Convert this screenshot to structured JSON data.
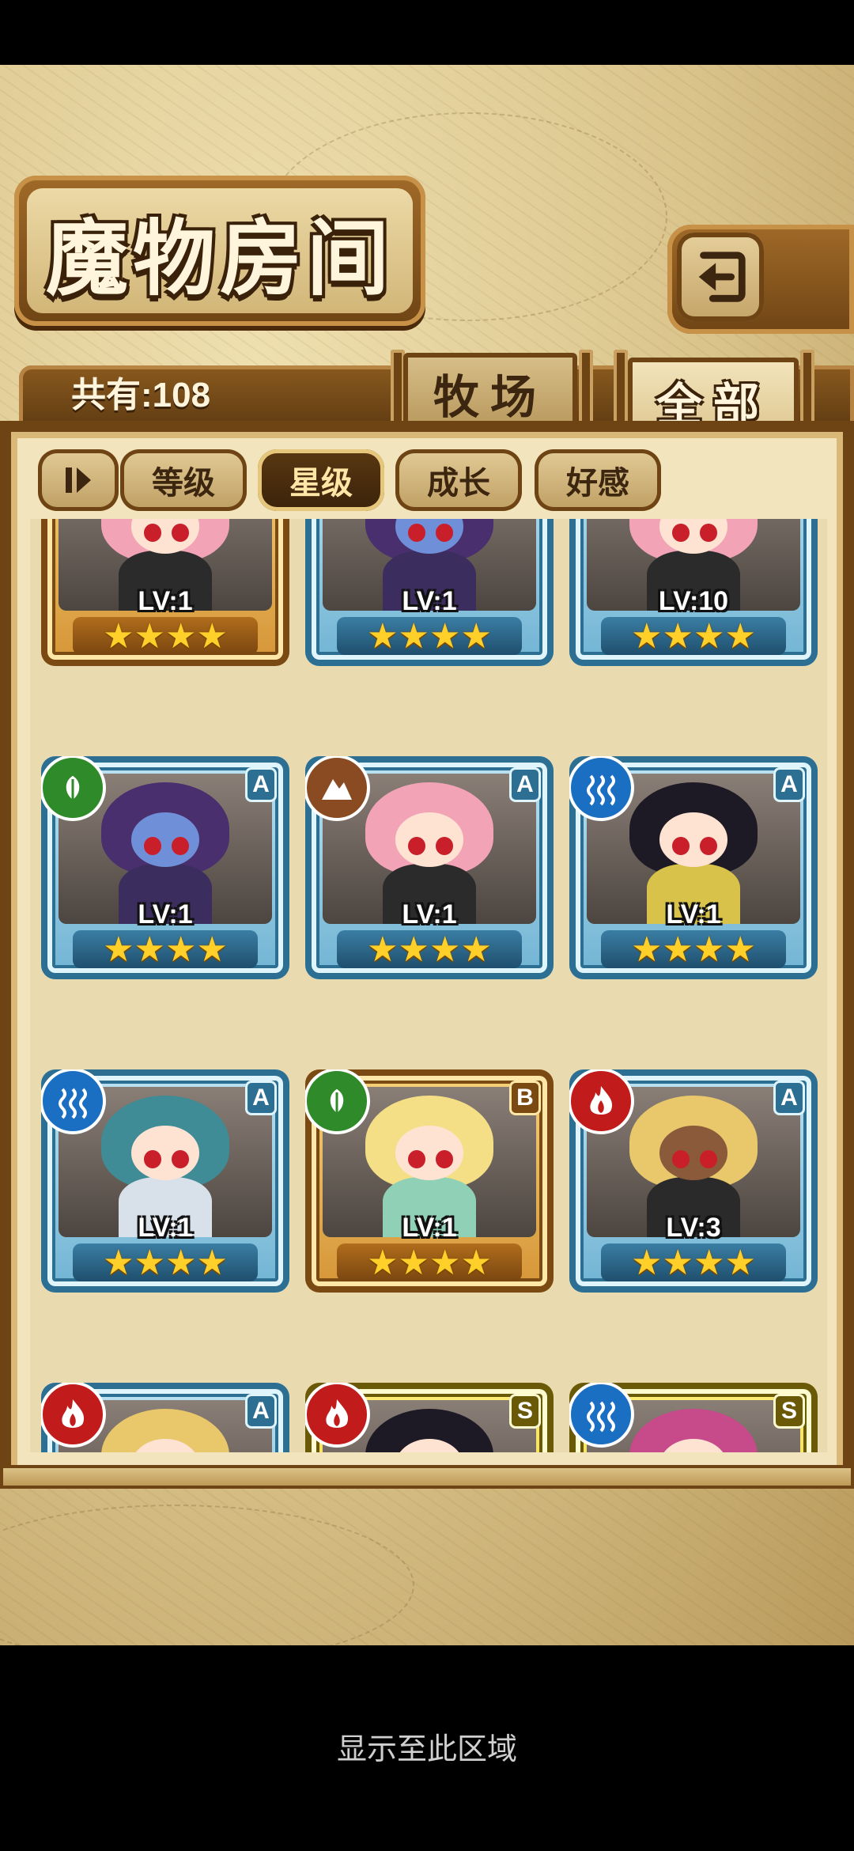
{
  "title": "魔物房间",
  "count_label": "共有:108",
  "tabs": [
    {
      "label": "牧场",
      "active": false
    },
    {
      "label": "全部",
      "active": true
    }
  ],
  "sort_buttons": [
    {
      "label": "等级",
      "active": false
    },
    {
      "label": "星级",
      "active": true
    },
    {
      "label": "成长",
      "active": false
    },
    {
      "label": "好感",
      "active": false
    }
  ],
  "cards": [
    {
      "level": "LV:1",
      "stars": "★★★★",
      "frame": "gold",
      "element": "",
      "rank": ""
    },
    {
      "level": "LV:1",
      "stars": "★★★★",
      "frame": "blue",
      "element": "",
      "rank": ""
    },
    {
      "level": "LV:10",
      "stars": "★★★★",
      "frame": "blue",
      "element": "",
      "rank": ""
    },
    {
      "level": "LV:1",
      "stars": "★★★★",
      "frame": "blue",
      "element": "grass",
      "rank": "A"
    },
    {
      "level": "LV:1",
      "stars": "★★★★",
      "frame": "blue",
      "element": "earth",
      "rank": "A"
    },
    {
      "level": "LV:1",
      "stars": "★★★★",
      "frame": "blue",
      "element": "water",
      "rank": "A"
    },
    {
      "level": "LV:1",
      "stars": "★★★★",
      "frame": "blue",
      "element": "water",
      "rank": "A"
    },
    {
      "level": "LV:1",
      "stars": "★★★★",
      "frame": "gold",
      "element": "grass",
      "rank": "B"
    },
    {
      "level": "LV:3",
      "stars": "★★★★",
      "frame": "blue",
      "element": "fire",
      "rank": "A"
    },
    {
      "level": "",
      "stars": "",
      "frame": "blue",
      "element": "fire",
      "rank": "A"
    },
    {
      "level": "",
      "stars": "",
      "frame": "yellow",
      "element": "fire",
      "rank": "S"
    },
    {
      "level": "",
      "stars": "",
      "frame": "yellow",
      "element": "water",
      "rank": "S"
    }
  ],
  "footer": "显示至此区域"
}
